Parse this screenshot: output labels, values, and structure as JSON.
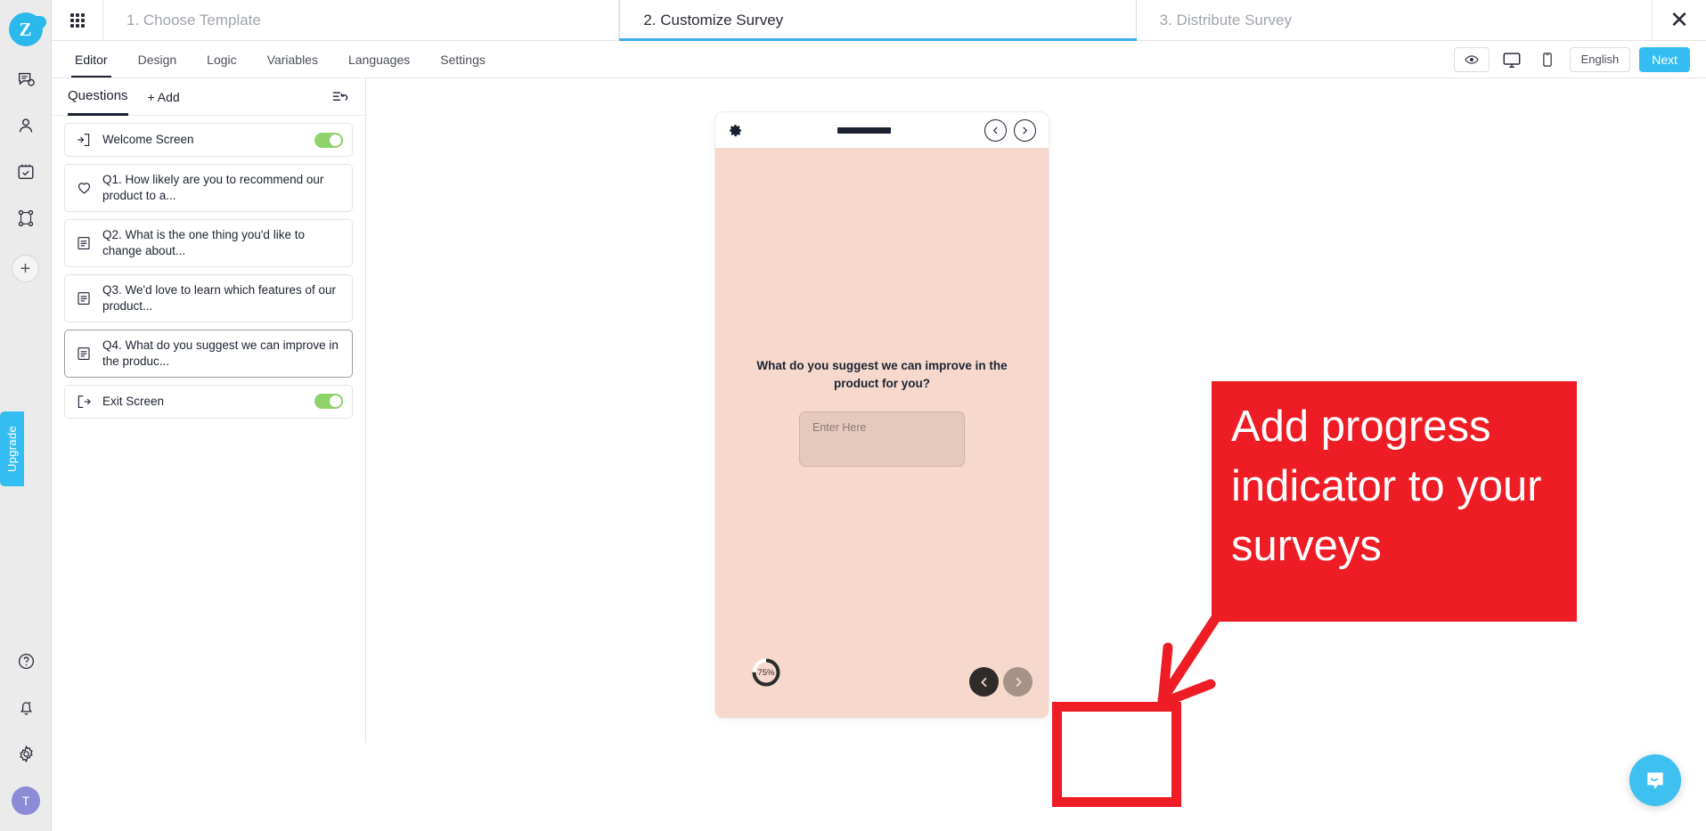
{
  "app": {
    "logo_letter": "Z",
    "upgrade_label": "Upgrade",
    "avatar_initial": "T"
  },
  "rail": {
    "items": [
      {
        "name": "chat-icon"
      },
      {
        "name": "contacts-icon"
      },
      {
        "name": "calendar-check-icon"
      },
      {
        "name": "workflow-icon"
      }
    ],
    "add_label": "+",
    "bottom_items": [
      {
        "name": "help-icon"
      },
      {
        "name": "bell-icon"
      },
      {
        "name": "gear-icon"
      }
    ]
  },
  "wizard": {
    "steps": [
      {
        "label": "1. Choose Template",
        "active": false
      },
      {
        "label": "2. Customize Survey",
        "active": true
      },
      {
        "label": "3. Distribute Survey",
        "active": false
      }
    ],
    "close_label": "✕"
  },
  "toolbar": {
    "tabs": [
      {
        "label": "Editor",
        "active": true
      },
      {
        "label": "Design",
        "active": false
      },
      {
        "label": "Logic",
        "active": false
      },
      {
        "label": "Variables",
        "active": false
      },
      {
        "label": "Languages",
        "active": false
      },
      {
        "label": "Settings",
        "active": false
      }
    ],
    "language_label": "English",
    "next_label": "Next"
  },
  "questions_panel": {
    "header_title": "Questions",
    "add_label": "Add",
    "items": [
      {
        "label": "Welcome Screen",
        "icon": "enter-screen-icon",
        "toggle": true,
        "selected": false
      },
      {
        "label": "Q1. How likely are you to recommend our product to a...",
        "icon": "heart-icon",
        "toggle": false,
        "selected": false
      },
      {
        "label": "Q2. What is the one thing you'd like to change about...",
        "icon": "text-field-icon",
        "toggle": false,
        "selected": false
      },
      {
        "label": "Q3. We'd love to learn which features of our product...",
        "icon": "text-field-icon",
        "toggle": false,
        "selected": false
      },
      {
        "label": "Q4. What do you suggest we can improve in the produc...",
        "icon": "text-field-icon",
        "toggle": false,
        "selected": true
      },
      {
        "label": "Exit Screen",
        "icon": "exit-screen-icon",
        "toggle": true,
        "selected": false
      }
    ]
  },
  "preview": {
    "question_text": "What do you suggest we can improve in the product for you?",
    "input_placeholder": "Enter Here",
    "progress_label": "75%",
    "progress_value": 75
  },
  "annotation": {
    "callout_text": "Add progress indicator to your surveys",
    "color": "#ee1c24"
  },
  "colors": {
    "brand_blue": "#33bdf0",
    "preview_bg": "#f6d8cc",
    "toggle_green": "#8ed26a",
    "avatar_purple": "#8b8bd6",
    "annotation_red": "#ee1c24"
  }
}
